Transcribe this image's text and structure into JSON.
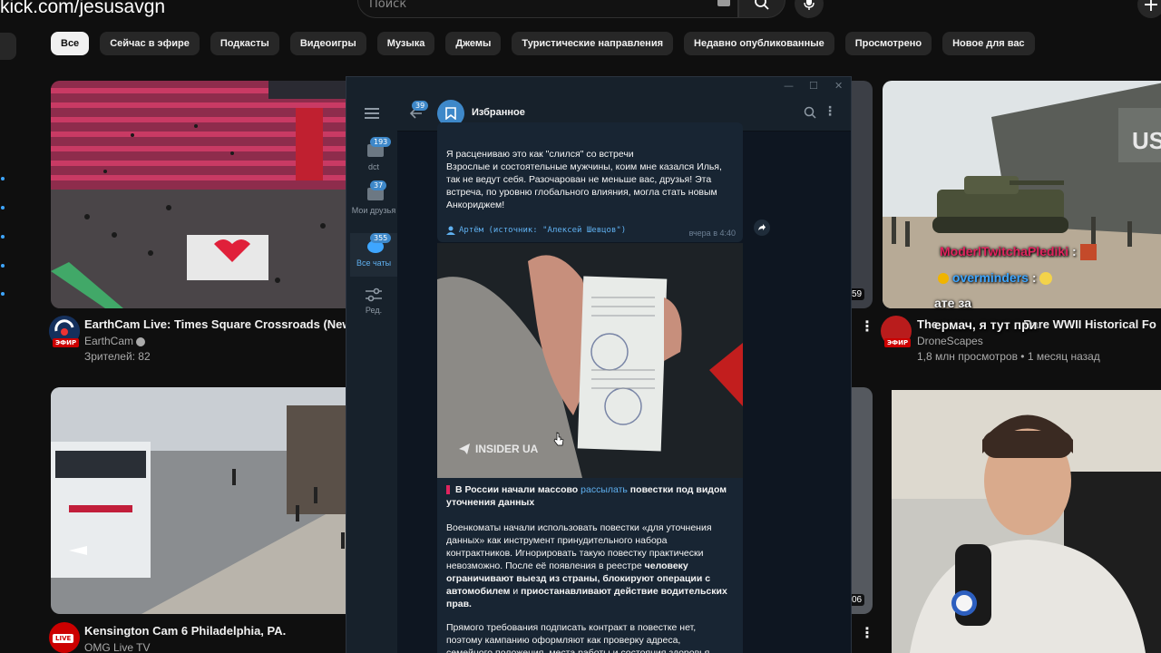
{
  "overlay": {
    "url": "kick.com/jesusavgn"
  },
  "youtube": {
    "search_placeholder": "Поиск",
    "create_label": "+",
    "chips": [
      "Все",
      "Сейчас в эфире",
      "Подкасты",
      "Видеоигры",
      "Музыка",
      "Джемы",
      "Туристические направления",
      "Недавно опубликованные",
      "Просмотрено",
      "Новое для вас"
    ],
    "videos": [
      {
        "title": "EarthCam Live:  Times Square Crossroads (New Yo",
        "channel": "EarthCam",
        "stats": "Зрителей: 82",
        "live_badge": "ЭФИР"
      },
      {
        "title": "Kensington Cam 6 Philadelphia, PA.",
        "channel": "OMG Live TV",
        "live_badge": "LIVE"
      },
      {
        "title": "The",
        "title_suffix": "Rare WWII Historical Fo",
        "channel": "DroneScapes",
        "stats": "1,8 млн просмотров • 1 месяц назад",
        "live_badge": "ЭФИР",
        "duration": "59"
      }
    ],
    "durations": [
      "06"
    ]
  },
  "chat_overlay": [
    {
      "user": "ModerlTwitchaPlediki",
      "sep": ":",
      "color": "#e0245e"
    },
    {
      "user": "overminders",
      "sep": ":",
      "color": "#3ea6ff"
    },
    {
      "text": "ате за"
    },
    {
      "text": "ермач, я тут при"
    }
  ],
  "telegram": {
    "window_controls": [
      "—",
      "☐",
      "✕"
    ],
    "folders": [
      {
        "label": "dct",
        "badge": "193"
      },
      {
        "label": "Мои друзья",
        "badge": "37"
      },
      {
        "label": "Все чаты",
        "badge": "355",
        "active": true
      },
      {
        "label": "Ред."
      }
    ],
    "back_badge": "39",
    "chat_name": "Избранное",
    "msg1": {
      "text": "Я расцениваю это как \"слился\" со встречи\nВзрослые и состоятельные мужчины, коим мне казался Илья, так не ведут себя. Разочарован не меньше вас, друзья! Эта встреча, по уровню глобального влияния, могла стать новым Анкориджем!",
      "signature": "Артём (источник: \"Алексей Шевцов\")",
      "time": "вчера в 4:40"
    },
    "photo_watermark": "INSIDER UA",
    "msg2": {
      "headline_start": "В России начали массово ",
      "headline_link": "рассылать",
      "headline_end": " повестки под видом уточнения данных",
      "p1_a": "Военкоматы начали использовать повестки «для уточнения данных» как инструмент принудительного набора контрактников. Игнорировать такую повестку практически невозможно. После её появления в реестре ",
      "p1_b": "человеку ограничивают выезд из страны, блокируют операции с автомобилем",
      "p1_c": " и ",
      "p1_d": "приостанавливают действие водительских прав.",
      "p2": "Прямого требования подписать контракт в повестке нет, поэтому кампанию оформляют как проверку адреса, семейного положения, места работы и состояния здоровья."
    }
  },
  "colors": {
    "telegram_accent": "#5fb0f0",
    "yt_bg": "#0f0f0f",
    "tg_bg": "#0e1621"
  }
}
